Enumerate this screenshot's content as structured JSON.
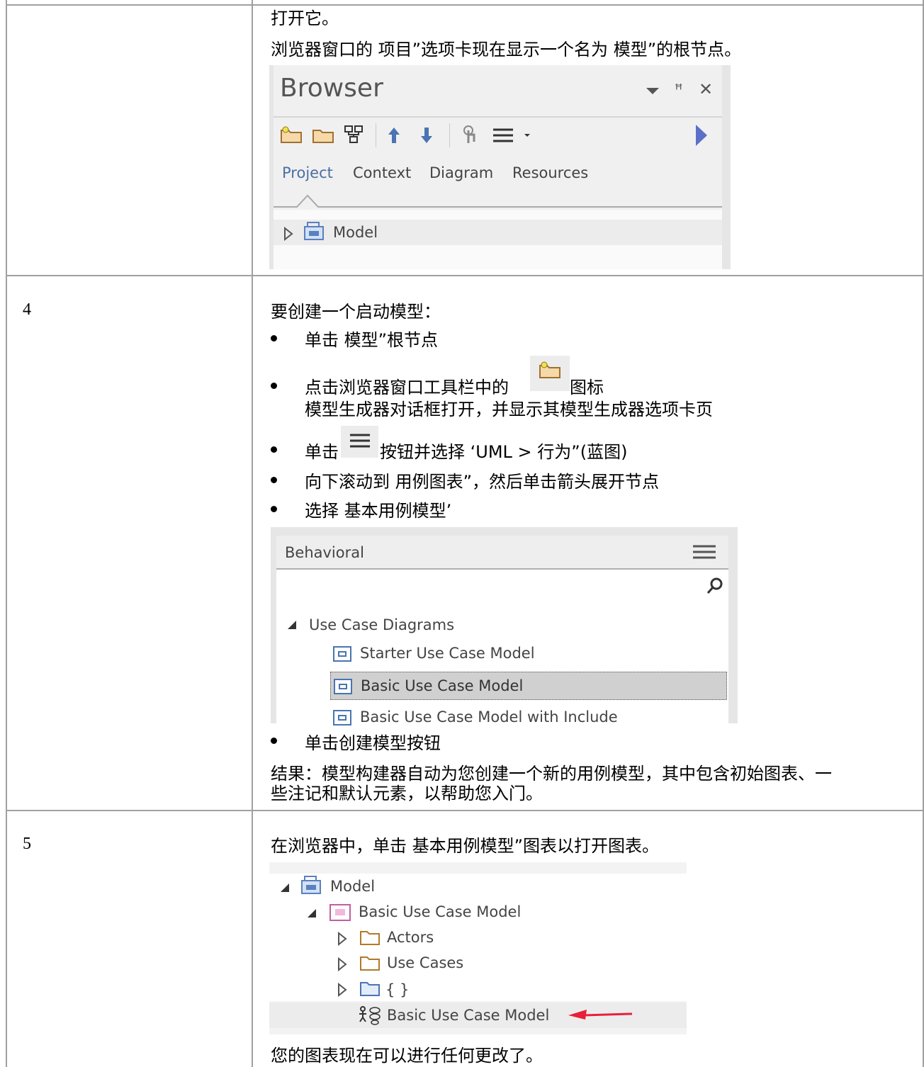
{
  "row3": {
    "line1": "打开它。",
    "line2": "浏览器窗口的 项目”选项卡现在显示一个名为 模型”的根节点。",
    "browser": {
      "title": "Browser",
      "title_icons": [
        "dropdown-arrow-icon",
        "pin-icon",
        "close-icon"
      ],
      "toolbar_icons": [
        "new-model-folder-icon",
        "new-package-folder-icon",
        "new-view-icon",
        "move-up-icon",
        "move-down-icon",
        "locate-icon",
        "menu-icon",
        "expand-arrow-icon"
      ],
      "tabs": [
        "Project",
        "Context",
        "Diagram",
        "Resources"
      ],
      "active_tab": "Project",
      "root_node": "Model"
    }
  },
  "row4": {
    "step": "4",
    "intro": "要创建一个启动模型：",
    "bullets": [
      "单击 模型”根节点",
      "点击浏览器窗口工具栏中的",
      "图标",
      "模型生成器对话框打开，并显示其模型生成器选项卡页",
      "单击",
      "按钮并选择 ‘UML > 行为”(蓝图)",
      "向下滚动到 用例图表”，然后单击箭头展开节点",
      "选择 基本用例模型’"
    ],
    "behavioral": {
      "header": "Behavioral",
      "group": "Use Case Diagrams",
      "items": [
        "Starter Use Case Model",
        "Basic Use Case Model",
        "Basic Use Case Model with Include"
      ],
      "selected_index": 1
    },
    "last_bullet": "单击创建模型按钮",
    "result_line1": "结果：模型构建器自动为您创建一个新的用例模型，其中包含初始图表、一",
    "result_line2": "些注记和默认元素，以帮助您入门。"
  },
  "row5": {
    "step": "5",
    "intro": "在浏览器中，单击 基本用例模型”图表以打开图表。",
    "tree": {
      "root": "Model",
      "package": "Basic Use Case Model",
      "children": [
        "Actors",
        "Use Cases",
        "{ }"
      ],
      "diagram": "Basic Use Case Model"
    },
    "footer": "您的图表现在可以进行任何更改了。"
  },
  "colors": {
    "grid": "#a0a0a0",
    "arrow": "#e8203a",
    "link_blue": "#4a74b3"
  }
}
